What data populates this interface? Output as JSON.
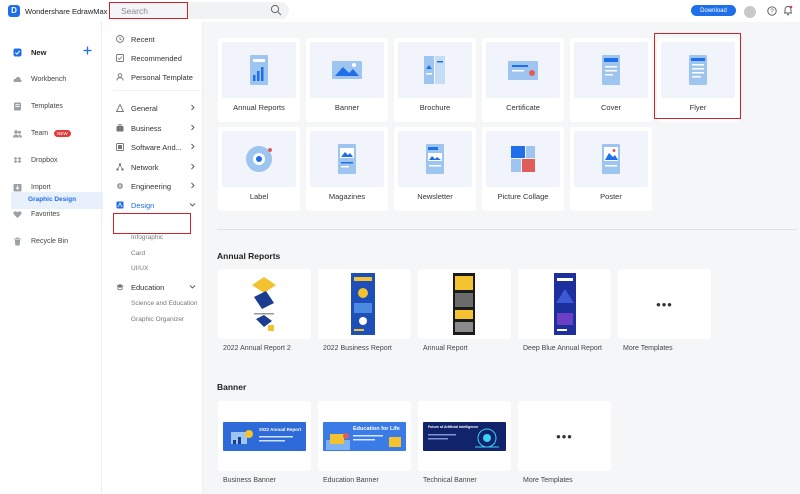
{
  "app": {
    "title": "Wondershare EdrawMax"
  },
  "search": {
    "placeholder": "Search"
  },
  "header": {
    "download_label": "Download"
  },
  "colors": {
    "accent": "#1f6feb",
    "highlight": "#d3202a",
    "badge": "#e23b3b"
  },
  "left_nav": {
    "new_label": "New",
    "items": [
      {
        "label": "Workbench",
        "icon": "cloud-icon"
      },
      {
        "label": "Templates",
        "icon": "template-icon"
      },
      {
        "label": "Team",
        "icon": "team-icon",
        "badge": "NEW"
      },
      {
        "label": "Dropbox",
        "icon": "dropbox-icon"
      },
      {
        "label": "Import",
        "icon": "import-icon"
      },
      {
        "label": "Favorites",
        "icon": "heart-icon"
      },
      {
        "label": "Recycle Bin",
        "icon": "trash-icon"
      }
    ]
  },
  "categories": {
    "top": [
      "Recent",
      "Recommended",
      "Personal Template"
    ],
    "groups": [
      "General",
      "Business",
      "Software And...",
      "Network",
      "Engineering",
      "Design"
    ],
    "design_subs": [
      "Graphic Design",
      "Infographic",
      "Card",
      "UI/UX"
    ],
    "education": "Education",
    "education_subs": [
      "Science and Education",
      "Graphic Organizer"
    ]
  },
  "templates": [
    {
      "label": "Annual Reports"
    },
    {
      "label": "Banner"
    },
    {
      "label": "Brochure"
    },
    {
      "label": "Certificate"
    },
    {
      "label": "Cover"
    },
    {
      "label": "Flyer"
    },
    {
      "label": "Label"
    },
    {
      "label": "Magazines"
    },
    {
      "label": "Newsletter"
    },
    {
      "label": "Picture Collage"
    },
    {
      "label": "Poster"
    }
  ],
  "annual_reports": {
    "title": "Annual Reports",
    "cards": [
      "2022 Annual Report 2",
      "2022 Business Report",
      "Annual Report",
      "Deep Blue Annual Report",
      "More Templates"
    ]
  },
  "banner_section": {
    "title": "Banner",
    "cards": [
      "Business Banner",
      "Education Banner",
      "Technical Banner",
      "More Templates"
    ],
    "art_text": [
      "2022 Annual Report",
      "Education for Life",
      "Future of Artificial Intelligence"
    ]
  },
  "more_dots": "•••"
}
